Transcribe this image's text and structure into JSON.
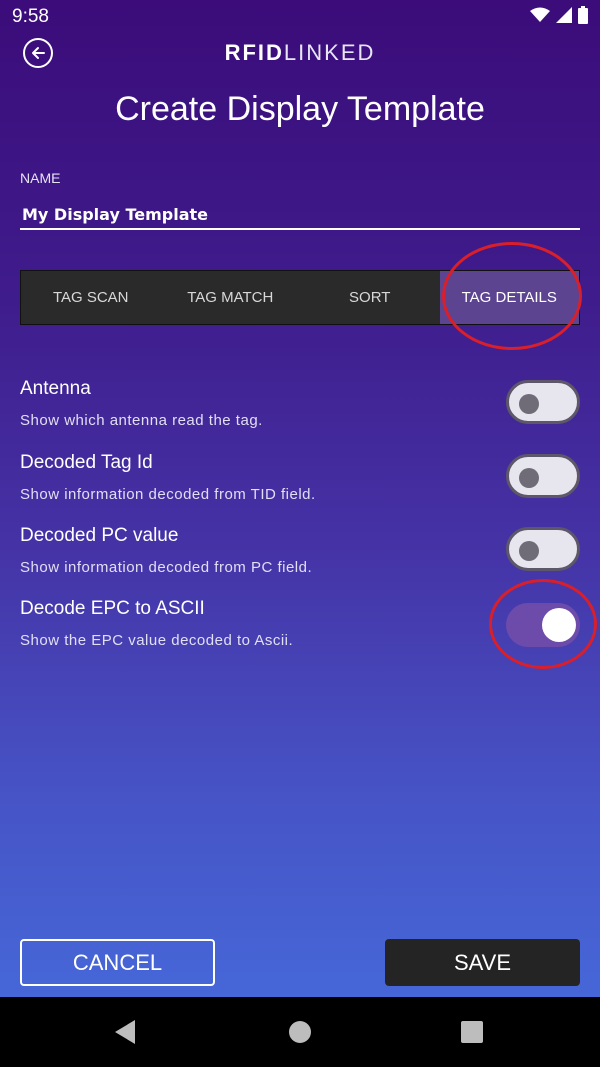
{
  "status_bar": {
    "time": "9:58",
    "icons": [
      "wifi-icon",
      "signal-icon",
      "battery-icon"
    ]
  },
  "header": {
    "logo_bold": "RFID",
    "logo_light": "LINKED",
    "title": "Create Display Template"
  },
  "name_field": {
    "label": "NAME",
    "value": "My Display Template"
  },
  "tabs": [
    {
      "label": "TAG SCAN",
      "active": false
    },
    {
      "label": "TAG MATCH",
      "active": false
    },
    {
      "label": "SORT",
      "active": false
    },
    {
      "label": "TAG DETAILS",
      "active": true
    }
  ],
  "settings": [
    {
      "title": "Antenna",
      "description": "Show which antenna read the tag.",
      "enabled": false
    },
    {
      "title": "Decoded Tag Id",
      "description": "Show information decoded from TID field.",
      "enabled": false
    },
    {
      "title": "Decoded PC value",
      "description": "Show information decoded from PC field.",
      "enabled": false
    },
    {
      "title": "Decode EPC to ASCII",
      "description": "Show the EPC value decoded to Ascii.",
      "enabled": true
    }
  ],
  "actions": {
    "cancel_label": "CANCEL",
    "save_label": "SAVE"
  },
  "colors": {
    "accent": "#6d4bab",
    "annotation": "#d91f2a",
    "tab_active": "#5d4491",
    "tab_bg": "#2a2a2a"
  }
}
